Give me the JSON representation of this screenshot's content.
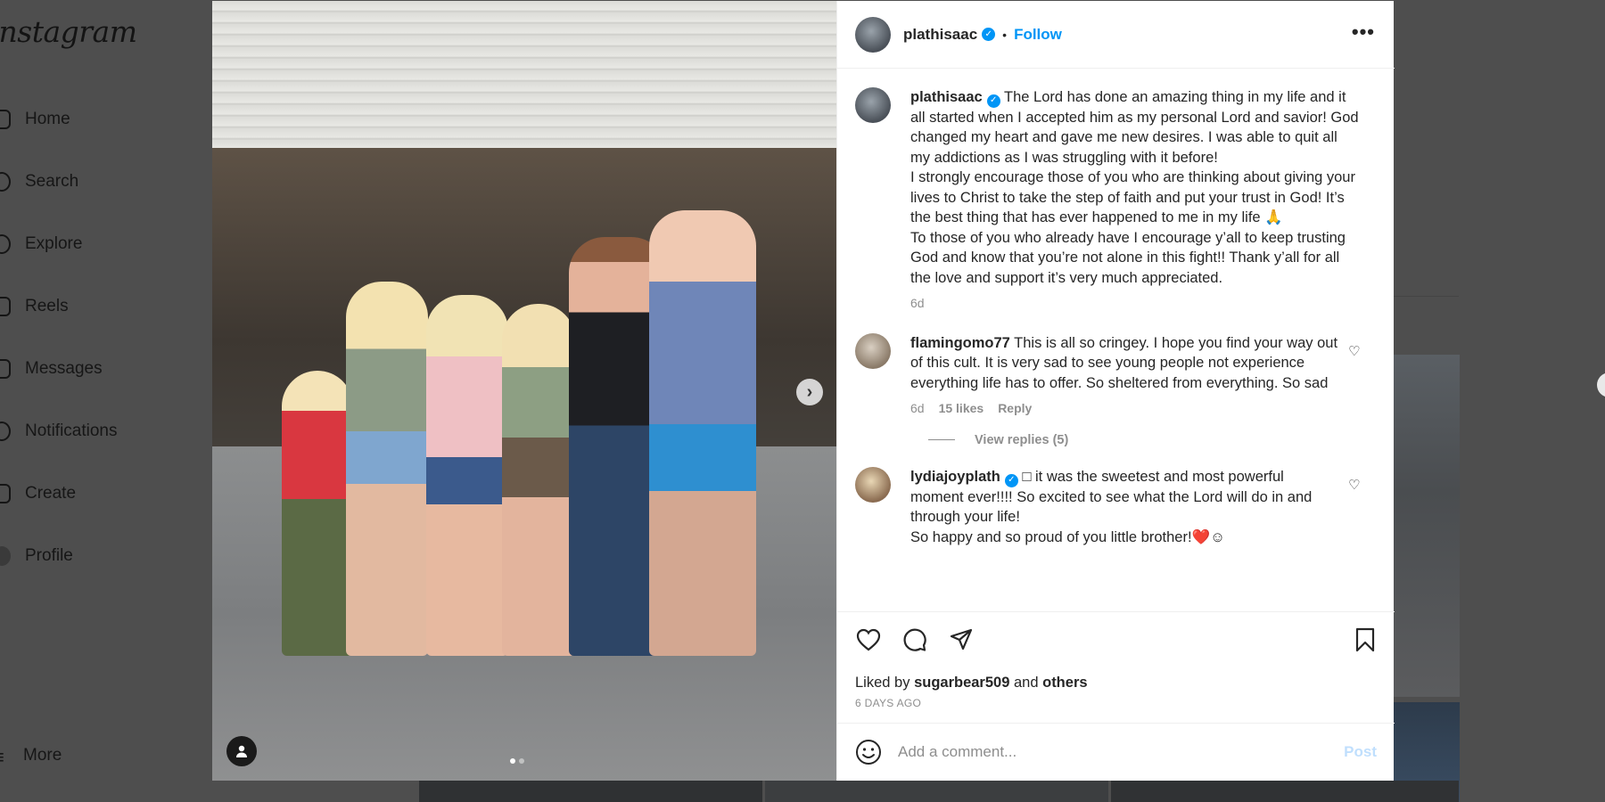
{
  "app": {
    "logo_text": "Instagram"
  },
  "sidebar": {
    "items": [
      {
        "label": "Home"
      },
      {
        "label": "Search"
      },
      {
        "label": "Explore"
      },
      {
        "label": "Reels"
      },
      {
        "label": "Messages"
      },
      {
        "label": "Notifications"
      },
      {
        "label": "Create"
      },
      {
        "label": "Profile"
      },
      {
        "label": "More"
      }
    ]
  },
  "post": {
    "username": "plathisaac",
    "separator": "•",
    "follow_label": "Follow",
    "more_label": "•••",
    "carousel": {
      "slides": 2,
      "current": 1
    },
    "caption": {
      "username": "plathisaac",
      "p1": "The Lord has done an amazing thing in my life and it all started when I accepted him as my personal Lord and savior! God changed my heart and gave me new desires. I was able to quit all my addictions as I was struggling with it before!",
      "p2": "I strongly encourage those of you who are thinking about giving your lives to Christ to take the step of faith and put your trust in God! It’s the best thing that has ever happened to me in my life 🙏",
      "p3": "To those of you who already have I encourage y’all to keep trusting God and know that you’re not alone in this fight!! Thank y’all for all the love and support it’s very much appreciated.",
      "time": "6d"
    },
    "comments": [
      {
        "username": "flamingomo77",
        "text": "This is all so cringey. I hope you find your way out of this cult. It is very sad to see young people not experience everything life has to offer. So sheltered from everything. So sad",
        "time": "6d",
        "likes": "15 likes",
        "reply_label": "Reply",
        "view_replies": "View replies (5)"
      },
      {
        "username": "lydiajoyplath",
        "text": "□ it was the sweetest and most powerful moment ever!!!! So excited to see what the Lord will do in and through your life!",
        "text2": "So happy and so proud of you little brother!❤️☺"
      }
    ],
    "liked_by_prefix": "Liked by",
    "liked_by_user": "sugarbear509",
    "liked_by_and": "and",
    "liked_by_others": "others",
    "date_ago": "6 DAYS AGO",
    "comment_placeholder": "Add a comment...",
    "post_label": "Post"
  }
}
